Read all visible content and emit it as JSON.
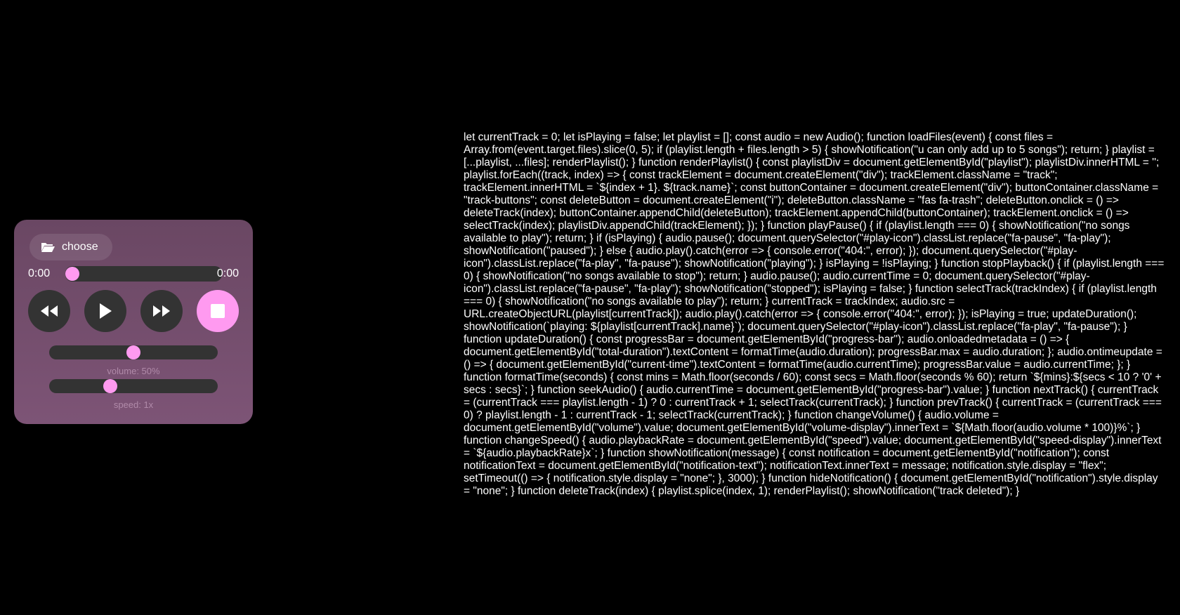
{
  "player": {
    "choose_label": "choose",
    "current_time": "0:00",
    "total_duration": "0:00",
    "progress_fraction": 0,
    "volume_fraction": 0.5,
    "speed_fraction": 0.35,
    "volume_text": "volume: 50%",
    "speed_text": "speed: 1x",
    "accent_color": "#ff9af0",
    "icons": {
      "folder": "folder-open-icon",
      "prev": "backward-icon",
      "play": "play-icon",
      "next": "forward-icon",
      "stop": "stop-icon"
    }
  },
  "code_text": "let currentTrack = 0; let isPlaying = false; let playlist = []; const audio = new Audio(); function loadFiles(event) { const files = Array.from(event.target.files).slice(0, 5); if (playlist.length + files.length > 5) { showNotification(\"u can only add up to 5 songs\"); return; } playlist = [...playlist, ...files]; renderPlaylist(); } function renderPlaylist() { const playlistDiv = document.getElementById(\"playlist\"); playlistDiv.innerHTML = ''; playlist.forEach((track, index) => { const trackElement = document.createElement(\"div\"); trackElement.className = \"track\"; trackElement.innerHTML = `${index + 1}. ${track.name}`; const buttonContainer = document.createElement(\"div\"); buttonContainer.className = \"track-buttons\"; const deleteButton = document.createElement(\"i\"); deleteButton.className = \"fas fa-trash\"; deleteButton.onclick = () => deleteTrack(index); buttonContainer.appendChild(deleteButton); trackElement.appendChild(buttonContainer); trackElement.onclick = () => selectTrack(index); playlistDiv.appendChild(trackElement); }); } function playPause() { if (playlist.length === 0) { showNotification(\"no songs available to play\"); return; } if (isPlaying) { audio.pause(); document.querySelector(\"#play-icon\").classList.replace(\"fa-pause\", \"fa-play\"); showNotification(\"paused\"); } else { audio.play().catch(error => { console.error(\"404:\", error); }); document.querySelector(\"#play-icon\").classList.replace(\"fa-play\", \"fa-pause\"); showNotification(\"playing\"); } isPlaying = !isPlaying; } function stopPlayback() { if (playlist.length === 0) { showNotification(\"no songs available to stop\"); return; } audio.pause(); audio.currentTime = 0; document.querySelector(\"#play-icon\").classList.replace(\"fa-pause\", \"fa-play\"); showNotification(\"stopped\"); isPlaying = false; } function selectTrack(trackIndex) { if (playlist.length === 0) { showNotification(\"no songs available to play\"); return; } currentTrack = trackIndex; audio.src = URL.createObjectURL(playlist[currentTrack]); audio.play().catch(error => { console.error(\"404:\", error); }); isPlaying = true; updateDuration(); showNotification(`playing: ${playlist[currentTrack].name}`); document.querySelector(\"#play-icon\").classList.replace(\"fa-play\", \"fa-pause\"); } function updateDuration() { const progressBar = document.getElementById(\"progress-bar\"); audio.onloadedmetadata = () => { document.getElementById(\"total-duration\").textContent = formatTime(audio.duration); progressBar.max = audio.duration; }; audio.ontimeupdate = () => { document.getElementById(\"current-time\").textContent = formatTime(audio.currentTime); progressBar.value = audio.currentTime; }; } function formatTime(seconds) { const mins = Math.floor(seconds / 60); const secs = Math.floor(seconds % 60); return `${mins}:${secs < 10 ? '0' + secs : secs}`; } function seekAudio() { audio.currentTime = document.getElementById(\"progress-bar\").value; } function nextTrack() { currentTrack = (currentTrack === playlist.length - 1) ? 0 : currentTrack + 1; selectTrack(currentTrack); } function prevTrack() { currentTrack = (currentTrack === 0) ? playlist.length - 1 : currentTrack - 1; selectTrack(currentTrack); } function changeVolume() { audio.volume = document.getElementById(\"volume\").value; document.getElementById(\"volume-display\").innerText = `${Math.floor(audio.volume * 100)}%`; } function changeSpeed() { audio.playbackRate = document.getElementById(\"speed\").value; document.getElementById(\"speed-display\").innerText = `${audio.playbackRate}x`; } function showNotification(message) { const notification = document.getElementById(\"notification\"); const notificationText = document.getElementById(\"notification-text\"); notificationText.innerText = message; notification.style.display = \"flex\"; setTimeout(() => { notification.style.display = \"none\"; }, 3000); } function hideNotification() { document.getElementById(\"notification\").style.display = \"none\"; } function deleteTrack(index) { playlist.splice(index, 1); renderPlaylist(); showNotification(\"track deleted\"); }"
}
